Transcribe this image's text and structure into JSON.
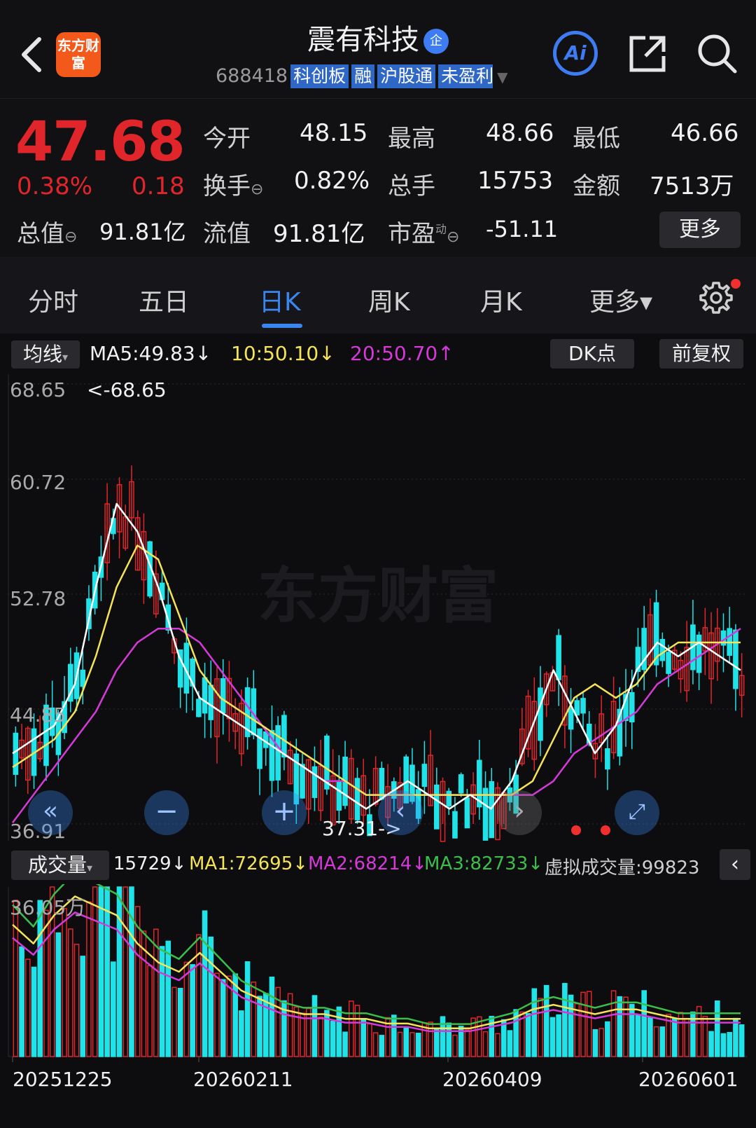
{
  "header": {
    "logo": "东方财富",
    "title": "震有科技",
    "company_badge": "企",
    "code": "688418",
    "tags": [
      "科创板",
      "融",
      "沪股通",
      "未盈利"
    ],
    "ai_label": "Ai"
  },
  "quote": {
    "price": "47.68",
    "change_pct": "0.38%",
    "change": "0.18",
    "open_label": "今开",
    "open": "48.15",
    "high_label": "最高",
    "high": "48.66",
    "low_label": "最低",
    "low": "46.66",
    "turnover_label": "换手",
    "turnover": "0.82%",
    "volume_label": "总手",
    "volume": "15753",
    "amount_label": "金额",
    "amount": "7513万",
    "mktcap_label": "总值",
    "mktcap": "91.81亿",
    "float_label": "流值",
    "float_cap": "91.81亿",
    "pe_label": "市盈",
    "pe_sup": "动",
    "pe": "-51.11",
    "more_label": "更多"
  },
  "tabs": [
    {
      "label": "分时",
      "active": false
    },
    {
      "label": "五日",
      "active": false
    },
    {
      "label": "日K",
      "active": true
    },
    {
      "label": "周K",
      "active": false
    },
    {
      "label": "月K",
      "active": false
    },
    {
      "label": "更多▾",
      "active": false
    }
  ],
  "ma_bar": {
    "dropdown": "均线",
    "ma5": "MA5:49.83↓",
    "ma10": "10:50.10↓",
    "ma20": "20:50.70↑",
    "dk_label": "DK点",
    "adj_label": "前复权"
  },
  "price_axis": {
    "ticks": [
      "68.65",
      "60.72",
      "52.78",
      "44.85",
      "36.91"
    ],
    "high_marker": "<-68.65",
    "low_marker": "37.31->"
  },
  "watermark": "东方财富",
  "volume_bar": {
    "dropdown": "成交量",
    "vol": "15729↓",
    "ma1": "MA1:72695↓",
    "ma2": "MA2:68214↓",
    "ma3": "MA3:82733↓",
    "virtual": "虚拟成交量:99823",
    "max_label": "36.05万"
  },
  "dates": [
    "20251225",
    "20260211",
    "20260409",
    "20260601"
  ],
  "colors": {
    "up": "#e0262a",
    "down": "#1fe3e8",
    "ma5": "#ffffff",
    "ma10": "#f5e35a",
    "ma20": "#d53ad8",
    "ma3": "#3bbf4a",
    "accent": "#3a86ee"
  },
  "chart_data": {
    "type": "candlestick",
    "price_range": [
      36.91,
      68.65
    ],
    "ma5_trend": [
      42,
      43,
      44,
      47,
      54,
      60,
      58,
      54,
      49,
      46,
      45,
      44,
      43,
      42,
      41,
      40,
      39,
      38,
      39,
      40,
      39,
      38,
      39,
      38,
      40,
      44,
      48,
      45,
      42,
      44,
      48,
      50,
      49,
      50,
      49,
      48
    ],
    "ma10_trend": [
      41,
      42,
      43,
      45,
      49,
      54,
      57,
      56,
      52,
      48,
      46,
      45,
      44,
      43,
      42,
      41,
      40,
      39,
      39,
      39,
      39,
      39,
      39,
      39,
      39,
      40,
      43,
      46,
      47,
      46,
      47,
      49,
      50,
      50,
      50,
      50
    ],
    "ma20_trend": [
      37,
      39,
      41,
      43,
      45,
      48,
      50,
      51,
      51,
      50,
      48,
      46,
      44,
      42,
      41,
      40,
      40,
      39,
      39,
      39,
      39,
      39,
      39,
      39,
      39,
      39,
      40,
      42,
      43,
      44,
      45,
      47,
      48,
      49,
      50,
      51
    ],
    "volume_ma_trend": [
      28,
      24,
      30,
      34,
      32,
      30,
      24,
      20,
      18,
      22,
      18,
      14,
      12,
      10,
      9,
      9,
      8,
      8,
      7,
      7,
      6,
      6,
      6,
      7,
      8,
      10,
      11,
      10,
      9,
      10,
      10,
      9,
      8,
      8,
      8,
      8
    ]
  }
}
